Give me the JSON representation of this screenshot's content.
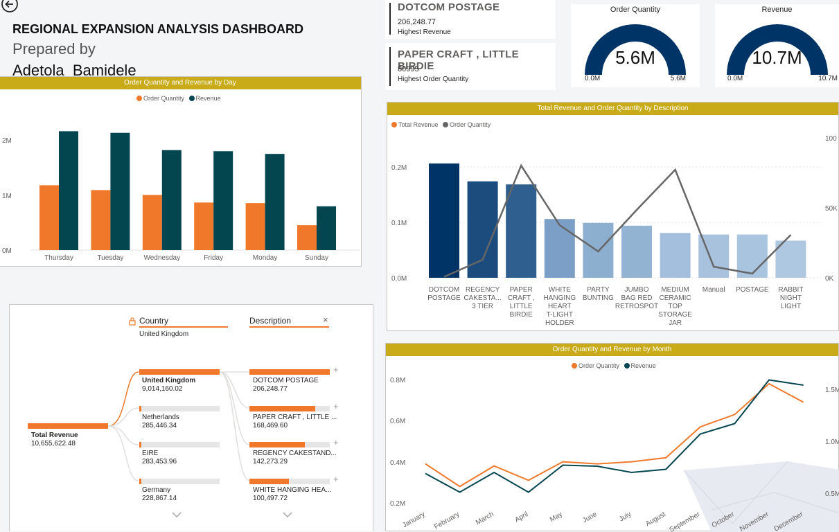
{
  "header": {
    "title": "REGIONAL EXPANSION ANALYSIS DASHBOARD",
    "prepared_by": "Prepared by",
    "author": "Adetola  Bamidele"
  },
  "kpi_cards": [
    {
      "title": "DOTCOM POSTAGE",
      "value": "206,248.77",
      "label": "Highest Revenue"
    },
    {
      "title": "PAPER CRAFT , LITTLE BIRDIE",
      "value": "80995",
      "label": "Highest Order Quantity"
    }
  ],
  "gauges": {
    "order_quantity": {
      "title": "Order Quantity",
      "value": "5.6M",
      "min_label": "0.0M",
      "max_label": "5.6M",
      "fill_fraction": 1.0
    },
    "revenue": {
      "title": "Revenue",
      "value": "10.7M",
      "min_label": "0.0M",
      "max_label": "10.7M",
      "fill_fraction": 1.0
    }
  },
  "colors": {
    "orange": "#f0782a",
    "teal": "#034650",
    "navy": "#003366",
    "gold": "#c9aa18",
    "grey_line": "#666666"
  },
  "charts": {
    "by_day": {
      "banner": "Order Quantity and Revenue by Day",
      "legend": [
        "Order Quantity",
        "Revenue"
      ],
      "yticks": [
        "2M",
        "1M",
        "0M"
      ]
    },
    "by_description": {
      "banner": "Total Revenue and Order Quantity by Description",
      "legend": [
        "Total Revenue",
        "Order Quantity"
      ],
      "yticks_left": [
        "0.2M",
        "0.1M",
        "0.0M"
      ],
      "yticks_right": [
        "100",
        "50K",
        "0K"
      ]
    },
    "by_month": {
      "banner": "Order Quantity and Revenue by Month",
      "legend": [
        "Order Quantity",
        "Revenue"
      ],
      "yticks_left": [
        "0.8M",
        "0.6M",
        "0.4M",
        "0.2M"
      ],
      "yticks_right": [
        "1.5M",
        "1.0M",
        "0.5M"
      ]
    }
  },
  "chart_data": [
    {
      "type": "bar",
      "title": "Order Quantity and Revenue by Day",
      "categories": [
        "Thursday",
        "Tuesday",
        "Wednesday",
        "Friday",
        "Monday",
        "Sunday"
      ],
      "series": [
        {
          "name": "Order Quantity",
          "values": [
            1200000,
            1110000,
            1020000,
            880000,
            870000,
            460000
          ]
        },
        {
          "name": "Revenue",
          "values": [
            2200000,
            2170000,
            1850000,
            1830000,
            1780000,
            810000
          ]
        }
      ],
      "ylim": [
        0,
        2500000
      ],
      "legend": "top-center"
    },
    {
      "type": "bar",
      "title": "Total Revenue and Order Quantity by Description",
      "categories": [
        "DOTCOM POSTAGE",
        "REGENCY CAKESTA... 3 TIER",
        "PAPER CRAFT , LITTLE BIRDIE",
        "WHITE HANGING HEART T-LIGHT HOLDER",
        "PARTY BUNTING",
        "JUMBO BAG RED RETROSPOT",
        "MEDIUM CERAMIC TOP STORAGE JAR",
        "Manual",
        "POSTAGE",
        "RABBIT NIGHT LIGHT"
      ],
      "series": [
        {
          "name": "Total Revenue",
          "values": [
            206248.77,
            174000,
            168469.6,
            106000,
            99000,
            94000,
            81000,
            78000,
            78000,
            67000
          ]
        },
        {
          "name": "Order Quantity",
          "values": [
            700,
            13000,
            80995,
            38000,
            19000,
            49000,
            78000,
            8000,
            3000,
            31000
          ]
        }
      ],
      "ylim_left": [
        0,
        0.25
      ],
      "ylim_right": [
        0,
        100000
      ],
      "legend": "top-left"
    },
    {
      "type": "line",
      "title": "Order Quantity and Revenue by Month",
      "categories": [
        "January",
        "February",
        "March",
        "April",
        "May",
        "June",
        "July",
        "August",
        "September",
        "October",
        "November",
        "December"
      ],
      "series": [
        {
          "name": "Order Quantity",
          "values": [
            0.39,
            0.28,
            0.38,
            0.31,
            0.4,
            0.39,
            0.4,
            0.42,
            0.57,
            0.63,
            0.78,
            0.69
          ]
        },
        {
          "name": "Revenue",
          "values": [
            0.69,
            0.51,
            0.7,
            0.51,
            0.77,
            0.76,
            0.7,
            0.73,
            1.07,
            1.17,
            1.59,
            1.54
          ]
        }
      ],
      "ylim_left": [
        0.2,
        0.8
      ],
      "ylim_right": [
        0.5,
        1.5
      ],
      "legend": "top-center"
    }
  ],
  "decomposition": {
    "col_country": "Country",
    "col_country_sub": "United Kingdom",
    "col_description": "Description",
    "root": {
      "label": "Total Revenue",
      "value": "10,655,622.48"
    },
    "countries": [
      {
        "label": "United Kingdom",
        "value": "9,014,160.02",
        "fraction": 1.0
      },
      {
        "label": "Netherlands",
        "value": "285,446.34",
        "fraction": 0.03
      },
      {
        "label": "EIRE",
        "value": "283,453.96",
        "fraction": 0.03
      },
      {
        "label": "Germany",
        "value": "228,867.14",
        "fraction": 0.03
      }
    ],
    "descriptions": [
      {
        "label": "DOTCOM POSTAGE",
        "value": "206,248.77",
        "fraction": 1.0
      },
      {
        "label": "PAPER CRAFT , LITTLE ...",
        "value": "168,469.60",
        "fraction": 0.82
      },
      {
        "label": "REGENCY CAKESTAND...",
        "value": "142,273.29",
        "fraction": 0.69
      },
      {
        "label": "WHITE HANGING HEA...",
        "value": "100,497.72",
        "fraction": 0.49
      }
    ]
  }
}
